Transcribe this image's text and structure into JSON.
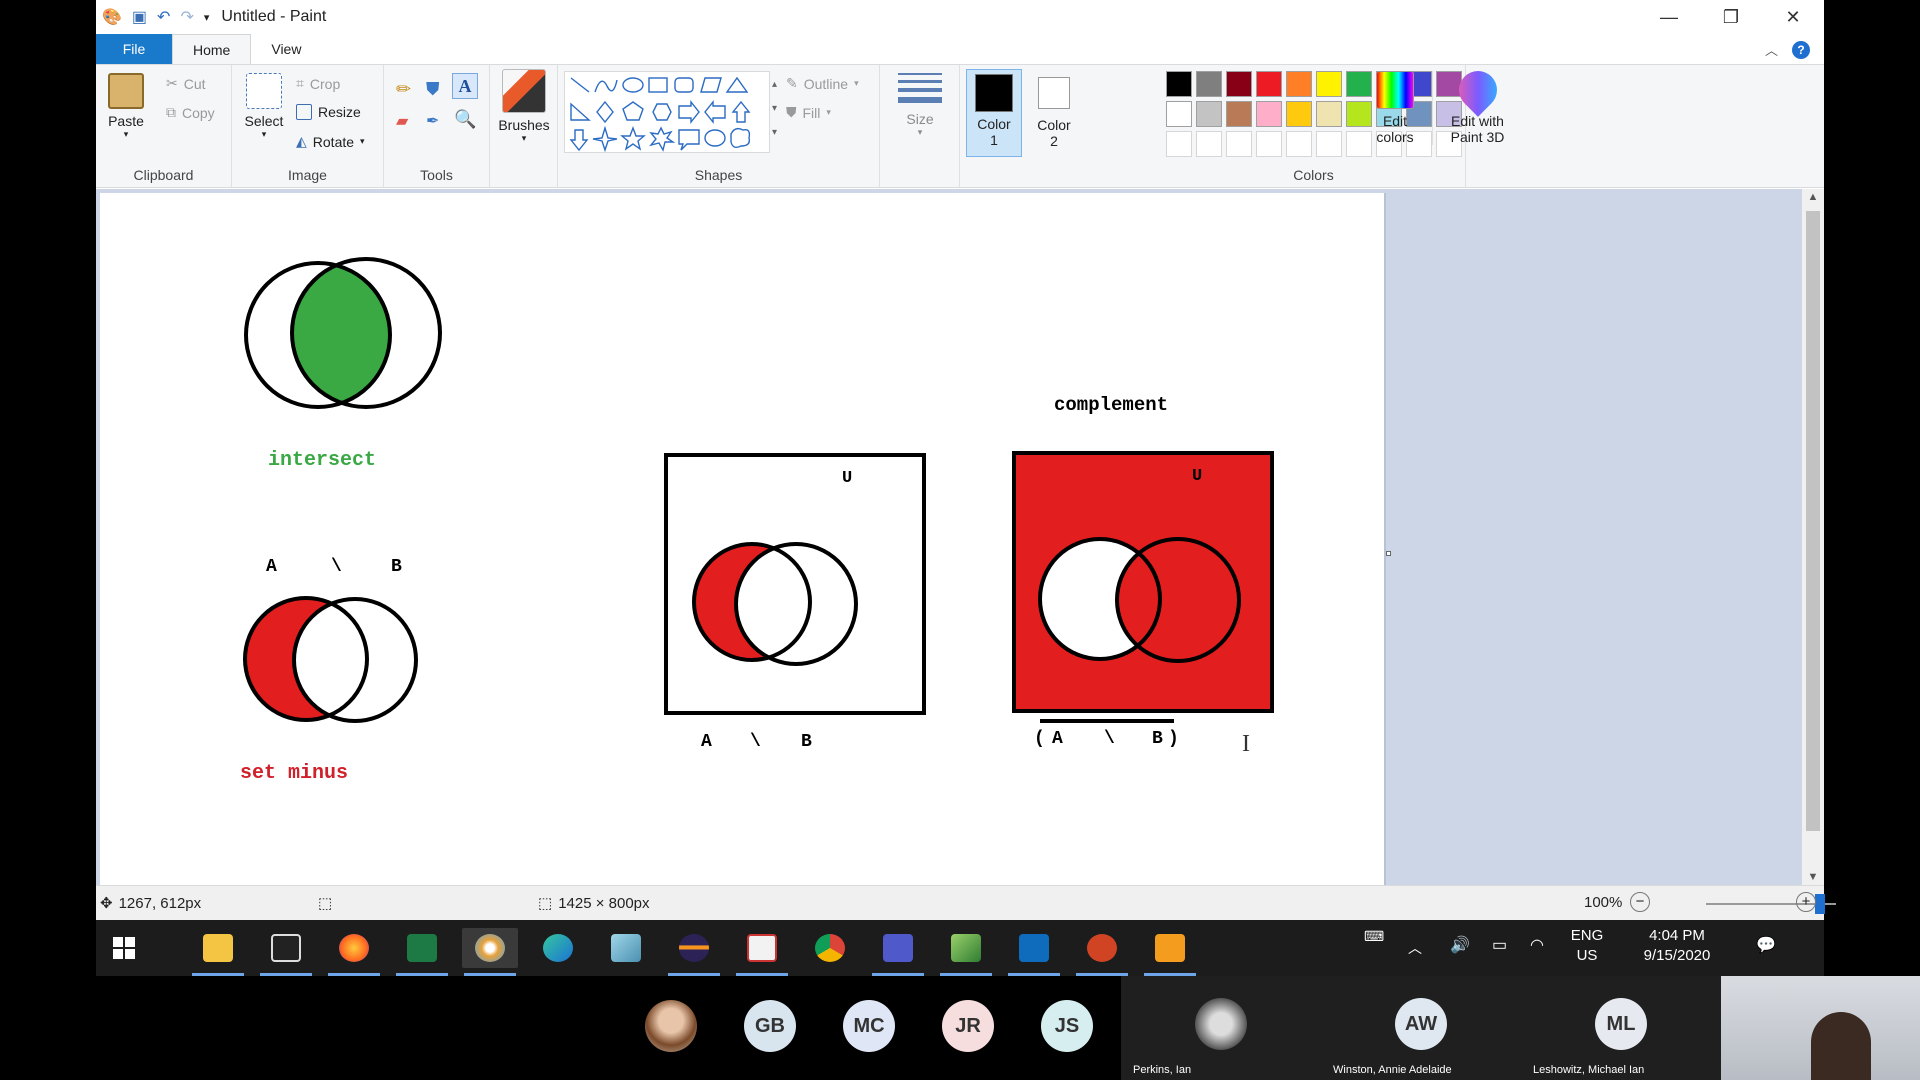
{
  "window": {
    "title": "Untitled - Paint",
    "controls": {
      "minimize": "—",
      "restore": "❐",
      "close": "✕"
    }
  },
  "tabs": [
    "File",
    "Home",
    "View"
  ],
  "ribbon": {
    "clipboard": {
      "label": "Clipboard",
      "paste": "Paste",
      "cut": "Cut",
      "copy": "Copy"
    },
    "image": {
      "label": "Image",
      "select": "Select",
      "crop": "Crop",
      "resize": "Resize",
      "rotate": "Rotate"
    },
    "tools": {
      "label": "Tools"
    },
    "brushes": {
      "label": "Brushes"
    },
    "shapes": {
      "label": "Shapes",
      "outline": "Outline",
      "fill": "Fill"
    },
    "size": {
      "label": "Size"
    },
    "color1": {
      "line1": "Color",
      "line2": "1"
    },
    "color2": {
      "line1": "Color",
      "line2": "2"
    },
    "colors": {
      "label": "Colors",
      "row1": [
        "#000000",
        "#7f7f7f",
        "#880015",
        "#ed1c24",
        "#ff7f27",
        "#fff200",
        "#22b14c",
        "#00a2e8",
        "#3f48cc",
        "#a349a4"
      ],
      "row2": [
        "#ffffff",
        "#c3c3c3",
        "#b97a57",
        "#ffaec9",
        "#ffc90e",
        "#efe4b0",
        "#b5e61d",
        "#99d9ea",
        "#7092be",
        "#c8bfe7"
      ]
    },
    "edit_colors": {
      "line1": "Edit",
      "line2": "colors"
    },
    "paint3d": {
      "line1": "Edit with",
      "line2": "Paint 3D"
    }
  },
  "canvas": {
    "intersect_label": "intersect",
    "set_minus_header": {
      "a": "A",
      "op": "\\",
      "b": "B"
    },
    "set_minus_label": "set minus",
    "universe_label": "U",
    "box1_caption": {
      "a": "A",
      "op": "\\",
      "b": "B"
    },
    "complement_title": "complement",
    "box2_caption": {
      "open": "(",
      "a": "A",
      "op": "\\",
      "b": "B",
      "close": ")"
    },
    "colors": {
      "green": "#3aa843",
      "red": "#e21e1e",
      "intersect_text": "#3aa843",
      "setminus_text": "#d0202a"
    }
  },
  "status": {
    "cursor_pos": "1267, 612px",
    "canvas_size": "1425 × 800px",
    "zoom": "100%"
  },
  "taskbar": {
    "apps": [
      "start",
      "file-explorer",
      "acrobat",
      "firefox",
      "excel",
      "paint",
      "edge",
      "notepad",
      "eclipse",
      "java",
      "chrome",
      "teams",
      "sheets-app",
      "outlook",
      "powerpoint",
      "media-player"
    ],
    "lang": {
      "line1": "ENG",
      "line2": "US"
    },
    "time": "4:04 PM",
    "date": "9/15/2020"
  },
  "meeting": {
    "participants": [
      {
        "initials": "GB",
        "color": "#d8e4ee"
      },
      {
        "initials": "MC",
        "color": "#dfe6f5"
      },
      {
        "initials": "JR",
        "color": "#f6dede"
      },
      {
        "initials": "JS",
        "color": "#d6eef0"
      }
    ],
    "tiles": [
      {
        "name": "Perkins, Ian"
      },
      {
        "name": "Winston, Annie Adelaide",
        "initials": "AW"
      },
      {
        "name": "Leshowitz, Michael Ian",
        "initials": "ML"
      }
    ]
  }
}
